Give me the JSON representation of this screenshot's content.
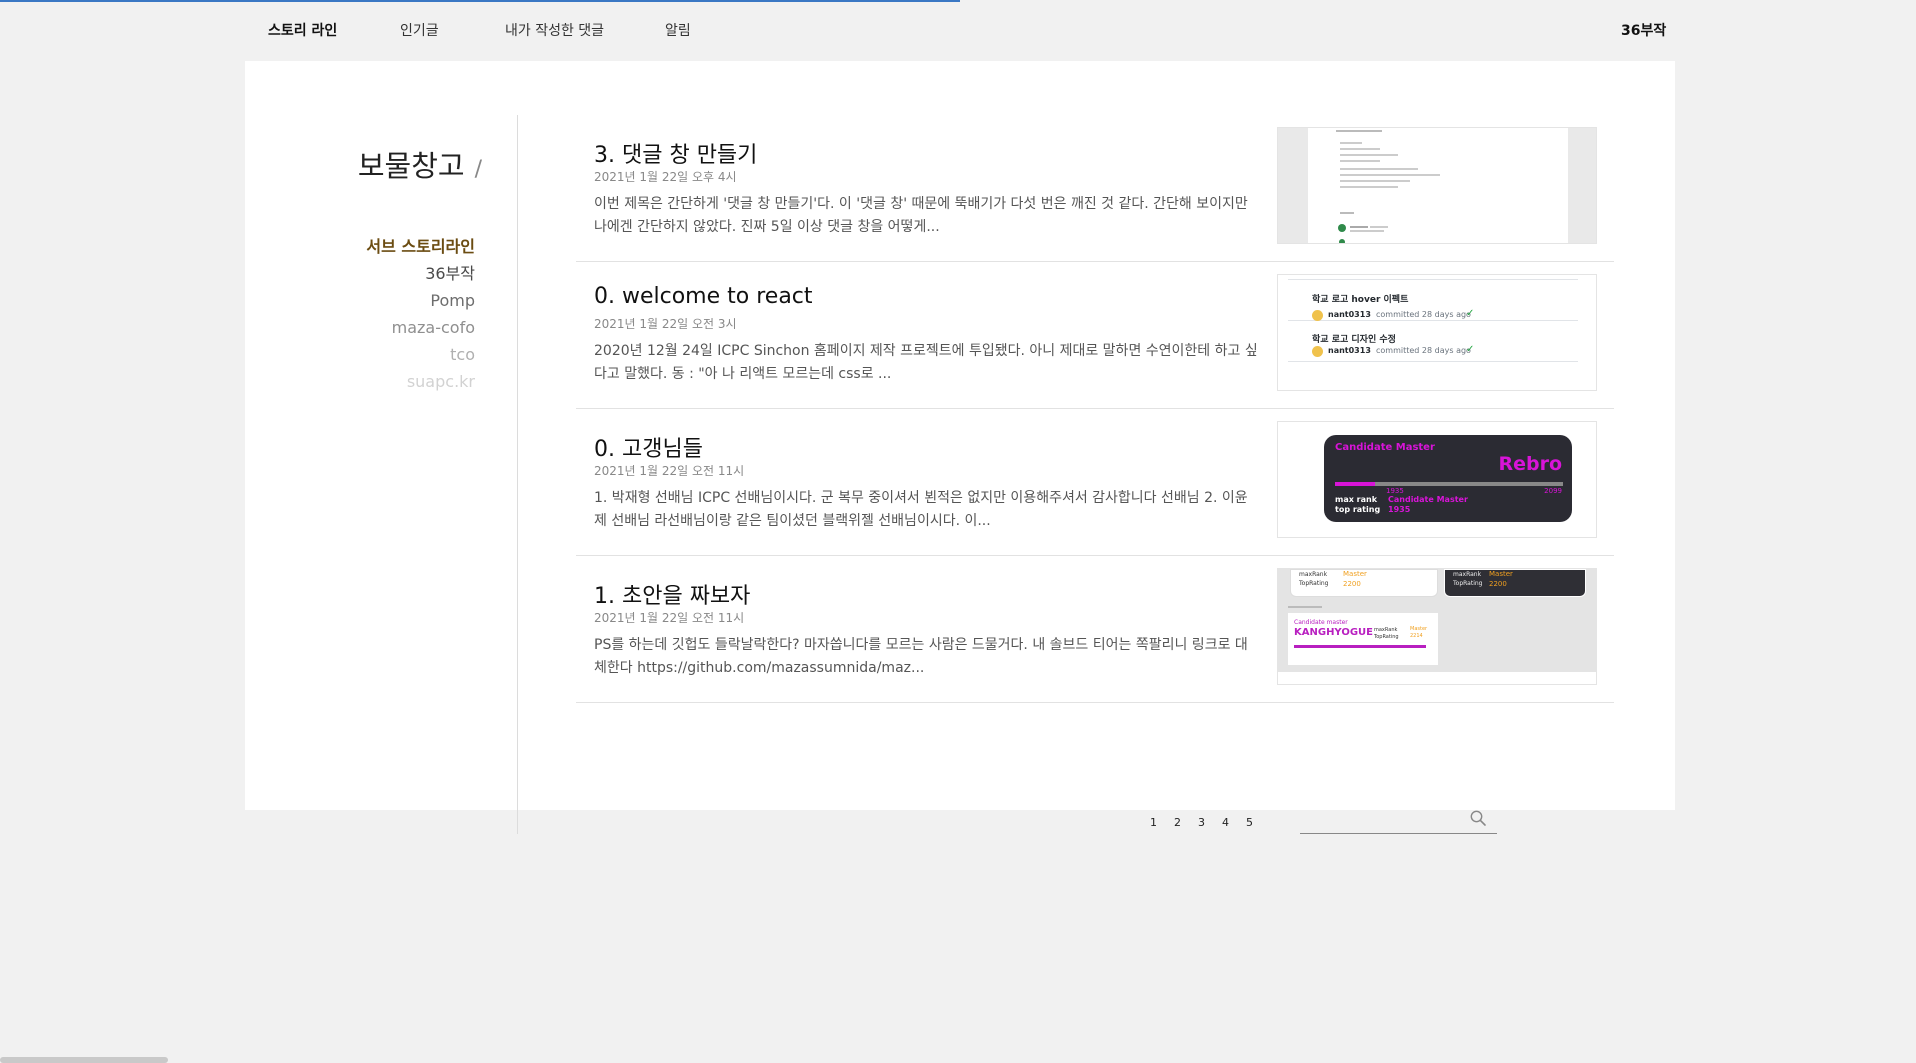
{
  "nav": {
    "items": [
      "스토리 라인",
      "인기글",
      "내가 작성한 댓글",
      "알림"
    ],
    "active_index": 0,
    "user": "36부작"
  },
  "blog": {
    "title": "보물창고",
    "separator": "/",
    "categories": [
      "서브 스토리라인",
      "36부작",
      "Pomp",
      "maza-cofo",
      "tco",
      "suapc.kr"
    ],
    "active_category": 0
  },
  "posts": [
    {
      "title": "3. 댓글 창 만들기",
      "date": "2021년 1월 22일 오후 4시",
      "excerpt": "이번 제목은 간단하게 '댓글 창 만들기'다. 이 '댓글 창' 때문에 뚝배기가 다섯 번은 깨진 것 같다. 간단해 보이지만 나에겐 간단하지 않았다. 진짜 5일 이상 댓글 창을 어떻게..."
    },
    {
      "title": "0. welcome to react",
      "date": "2021년 1월 22일 오전 3시",
      "excerpt": "2020년 12월 24일 ICPC Sinchon 홈페이지 제작 프로젝트에 투입됐다. 아니 제대로 말하면 수연이한테 하고 싶다고 말했다. 동 : \"아 나 리액트 모르는데 css로 ...",
      "thumb": {
        "commits": [
          {
            "title": "학교 로고 hover 이펙트",
            "user": "nant0313",
            "meta": "committed 28 days ago"
          },
          {
            "title": "학교 로고 디자인 수정",
            "user": "nant0313",
            "meta": "committed 28 days ago"
          }
        ]
      }
    },
    {
      "title": "0. 고갱님들",
      "date": "2021년 1월 22일 오전 11시",
      "excerpt": "1. 박재형 선배님 ICPC 선배님이시다. 군 복무 중이셔서 뵌적은 없지만 이용해주셔서 감사합니다 선배님 2. 이윤제 선배님 라선배님이랑 같은 팀이셨던 블랙위젤 선배님이시다. 이...",
      "thumb": {
        "rank_label": "Candidate Master",
        "handle": "Rebro",
        "min": "1935",
        "max": "2099",
        "max_rank_label": "max rank",
        "max_rank": "Candidate Master",
        "top_rating_label": "top rating",
        "top_rating": "1935"
      }
    },
    {
      "title": "1. 초안을 짜보자",
      "date": "2021년 1월 22일 오전 11시",
      "excerpt": "PS를 하는데 깃헙도 들락날락한다? 마자씁니다를 모르는 사람은 드물거다. 내 솔브드 티어는 쪽팔리니 링크로 대체한다 https://github.com/mazassumnida/maz...",
      "thumb": {
        "card_a": {
          "k1": "maxRank",
          "v1": "Master",
          "k2": "TopRating",
          "v2": "2200"
        },
        "card_b": {
          "k1": "maxRank",
          "v1": "Master",
          "k2": "TopRating",
          "v2": "2200"
        },
        "card_c": {
          "rank": "Candidate master",
          "handle": "KANGHYOGUE",
          "k1": "maxRank",
          "v1": "Master",
          "k2": "TopRating",
          "v2": "2214"
        }
      }
    }
  ],
  "pagination": [
    "1",
    "2",
    "3",
    "4",
    "5"
  ],
  "search": {
    "placeholder": ""
  },
  "colors": {
    "accent_category": "#6b4c12",
    "loadbar": "#3a78c4",
    "rank_magenta": "#d814d8"
  }
}
